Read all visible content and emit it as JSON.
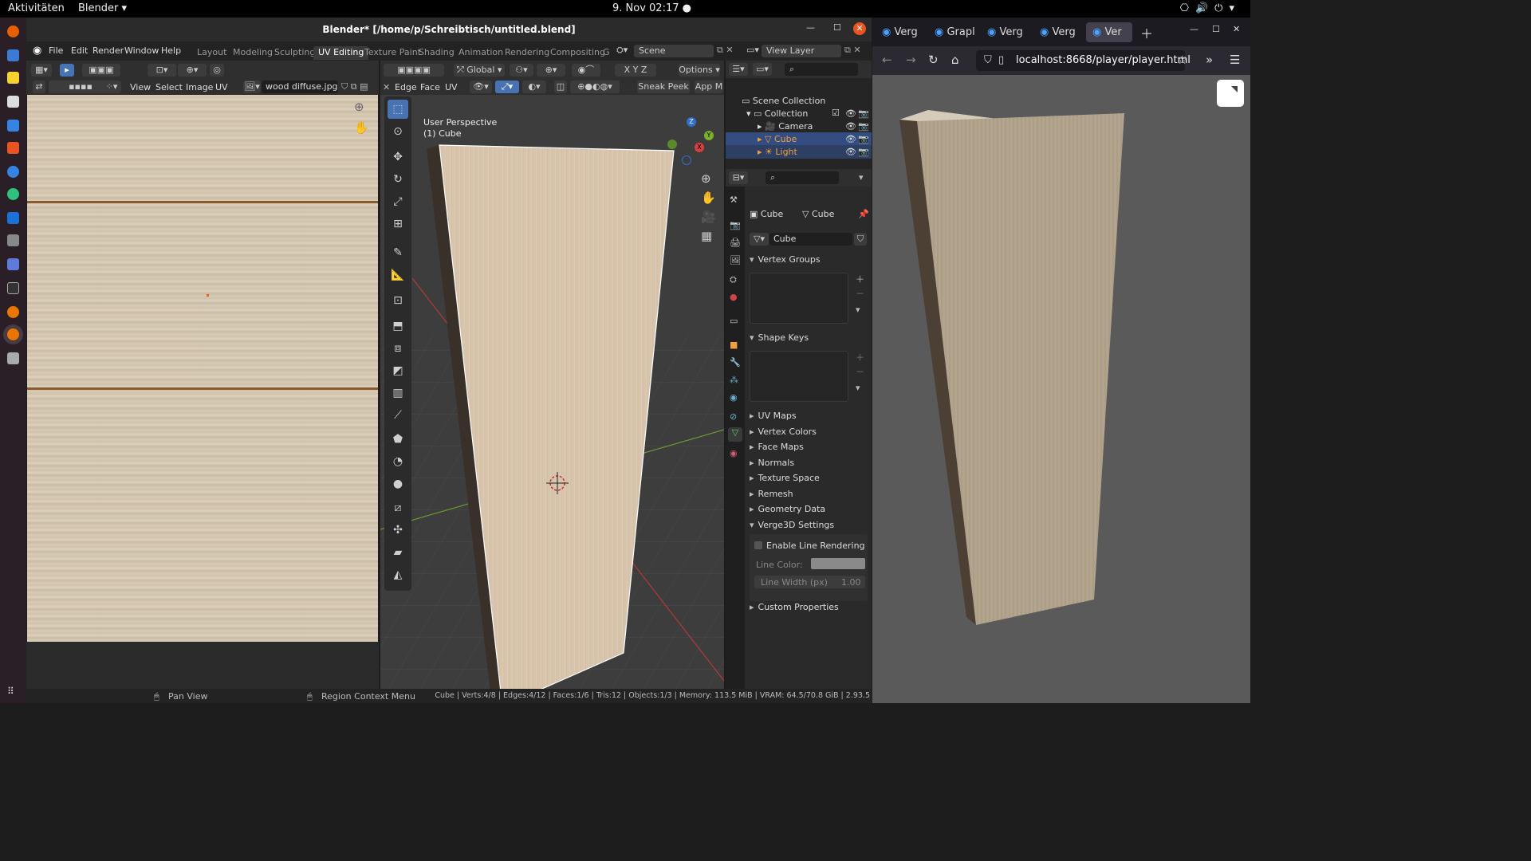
{
  "topbar": {
    "activities": "Aktivitäten",
    "app": "Blender ▾",
    "clock": "9. Nov  02:17  ●"
  },
  "blender": {
    "title": "Blender* [/home/p/Schreibtisch/untitled.blend]",
    "menu": [
      "File",
      "Edit",
      "Render",
      "Window",
      "Help"
    ],
    "workspaces": [
      "Layout",
      "Modeling",
      "Sculpting",
      "UV Editing",
      "Texture Paint",
      "Shading",
      "Animation",
      "Rendering",
      "Compositing",
      "G"
    ],
    "active_workspace": "UV Editing",
    "scene": "Scene",
    "view_layer": "View Layer",
    "uv_editor": {
      "menus": [
        "View",
        "Select",
        "Image",
        "UV"
      ],
      "image_name": "wood diffuse.jpg"
    },
    "viewport": {
      "menus": [
        "Edge",
        "Face",
        "UV"
      ],
      "transform_orientation": "Global",
      "options_label": "Options",
      "sneak_peek": "Sneak Peek",
      "app_label": "App M",
      "overlay_text_1": "User Perspective",
      "overlay_text_2": "(1) Cube",
      "axis_x": "X",
      "axis_y": "Y",
      "axis_z": "Z"
    },
    "outliner": {
      "items": [
        {
          "label": "Scene Collection"
        },
        {
          "label": "Collection"
        },
        {
          "label": "Camera"
        },
        {
          "label": "Cube"
        },
        {
          "label": "Light"
        }
      ]
    },
    "properties": {
      "object_name": "Cube",
      "mesh_name": "Cube",
      "data_field": "Cube",
      "panels": {
        "vertex_groups": "Vertex Groups",
        "shape_keys": "Shape Keys",
        "uv_maps": "UV Maps",
        "vertex_colors": "Vertex Colors",
        "face_maps": "Face Maps",
        "normals": "Normals",
        "texture_space": "Texture Space",
        "remesh": "Remesh",
        "geometry_data": "Geometry Data",
        "verge3d": "Verge3D Settings",
        "custom_props": "Custom Properties"
      },
      "enable_line_rendering": "Enable Line Rendering",
      "line_color_label": "Line Color:",
      "line_width_label": "Line Width (px)",
      "line_width_value": "1.00"
    },
    "statusbar": {
      "pan_view": "Pan View",
      "region_menu": "Region Context Menu",
      "stats": "Cube | Verts:4/8 | Edges:4/12 | Faces:1/6 | Tris:12 | Objects:1/3 | Memory: 113.5 MiB | VRAM: 64.5/70.8 GiB | 2.93.5"
    }
  },
  "browser": {
    "tabs": [
      "Verg",
      "Grapl",
      "Verg",
      "Verg",
      "Ver"
    ],
    "url": "localhost:8668/player/player.html"
  },
  "colors": {
    "accent": "#4772b3",
    "selected_row": "#334d80",
    "wood": "#d3c6b0"
  }
}
